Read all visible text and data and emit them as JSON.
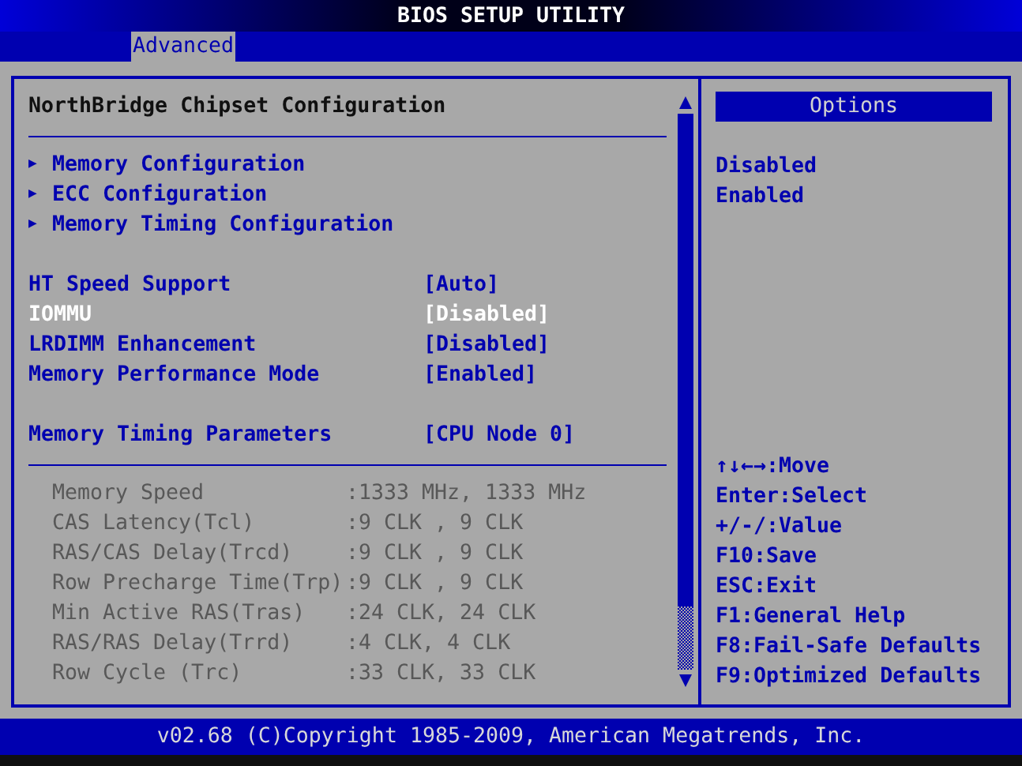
{
  "window": {
    "title": "BIOS SETUP UTILITY"
  },
  "tabs": [
    {
      "label": "Advanced",
      "selected": true
    }
  ],
  "panel": {
    "title": "NorthBridge Chipset Configuration",
    "submenus": [
      {
        "arrow": "▶",
        "label": "Memory Configuration"
      },
      {
        "arrow": "▶",
        "label": "ECC Configuration"
      },
      {
        "arrow": "▶",
        "label": "Memory Timing Configuration"
      }
    ],
    "setting_groups": [
      [
        {
          "label": "HT Speed Support",
          "value": "[Auto]",
          "selected": false
        },
        {
          "label": "IOMMU",
          "value": "[Disabled]",
          "selected": true
        },
        {
          "label": "LRDIMM Enhancement",
          "value": "[Disabled]",
          "selected": false
        },
        {
          "label": "Memory Performance Mode",
          "value": "[Enabled]",
          "selected": false
        }
      ],
      [
        {
          "label": "Memory Timing Parameters",
          "value": "[CPU Node 0]",
          "selected": false
        }
      ]
    ],
    "info": [
      {
        "label": "Memory Speed",
        "value": ":1333 MHz, 1333 MHz",
        "disabled": true
      },
      {
        "label": "CAS Latency(Tcl)",
        "value": ":9 CLK , 9 CLK",
        "disabled": true
      },
      {
        "label": "RAS/CAS Delay(Trcd)",
        "value": ":9 CLK , 9 CLK",
        "disabled": true
      },
      {
        "label": "Row Precharge Time(Trp)",
        "value": ":9 CLK , 9 CLK",
        "disabled": true
      },
      {
        "label": "Min Active RAS(Tras)",
        "value": ":24 CLK, 24 CLK",
        "disabled": true
      },
      {
        "label": "RAS/RAS Delay(Trrd)",
        "value": ":4 CLK, 4 CLK",
        "disabled": true
      },
      {
        "label": "Row Cycle (Trc)",
        "value": ":33 CLK, 33 CLK",
        "disabled": true
      }
    ]
  },
  "options": {
    "title": "Options",
    "items": [
      "Disabled",
      "Enabled"
    ]
  },
  "help": [
    "↑↓←→:Move",
    "Enter:Select",
    "+/-/:Value",
    "F10:Save",
    "ESC:Exit",
    "F1:General Help",
    "F8:Fail-Safe Defaults",
    "F9:Optimized Defaults"
  ],
  "footer": "v02.68 (C)Copyright 1985-2009, American Megatrends, Inc."
}
